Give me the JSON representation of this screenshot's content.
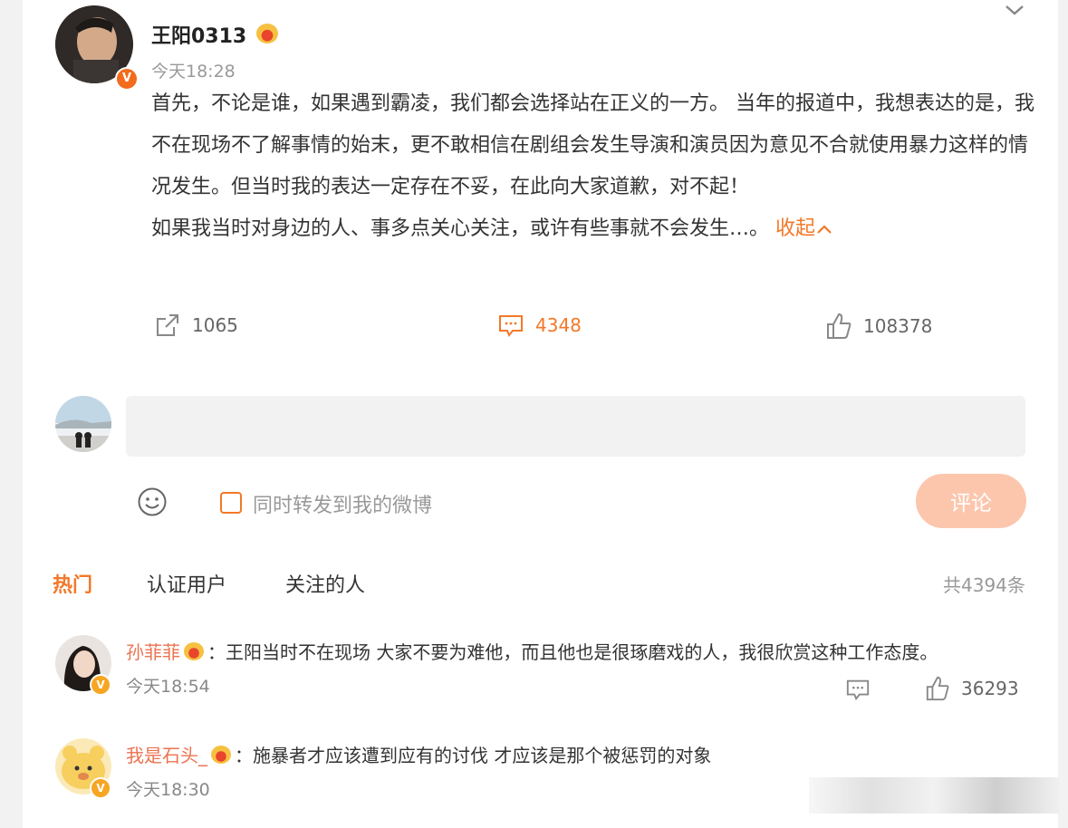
{
  "post": {
    "username": "王阳0313",
    "timestamp": "今天18:28",
    "verified_badge": "V",
    "paragraphs": [
      "首先，不论是谁，如果遇到霸凌，我们都会选择站在正义的一方。 当年的报道中，我想表达的是，我不在现场不了解事情的始末，更不敢相信在剧组会发生导演和演员因为意见不合就使用暴力这样的情况发生。但当时我的表达一定存在不妥，在此向大家道歉，对不起！",
      "如果我当时对身边的人、事多点关心关注，或许有些事就不会发生…。"
    ],
    "collapse_label": "收起",
    "actions": {
      "repost_count": "1065",
      "comment_count": "4348",
      "like_count": "108378"
    }
  },
  "reply_box": {
    "placeholder": "",
    "forward_label": "同时转发到我的微博",
    "submit_label": "评论"
  },
  "tabs": {
    "items": [
      "热门",
      "认证用户",
      "关注的人"
    ],
    "total": "共4394条"
  },
  "comments": [
    {
      "name": "孙菲菲",
      "text": "王阳当时不在现场 大家不要为难他，而且他也是很琢磨戏的人，我很欣赏这种工作态度。",
      "time": "今天18:54",
      "likes": "36293",
      "badge": "V"
    },
    {
      "name": "我是石头_",
      "text": "施暴者才应该遭到应有的讨伐 才应该是那个被惩罚的对象",
      "time": "今天18:30",
      "badge": "V"
    }
  ],
  "colors": {
    "accent": "#f37828",
    "name_link": "#eb7350",
    "submit_disabled": "#fcc6ad"
  },
  "icons": [
    "chevron-down-icon",
    "crown-icon",
    "repost-icon",
    "comment-icon",
    "like-icon",
    "emoji-icon"
  ]
}
